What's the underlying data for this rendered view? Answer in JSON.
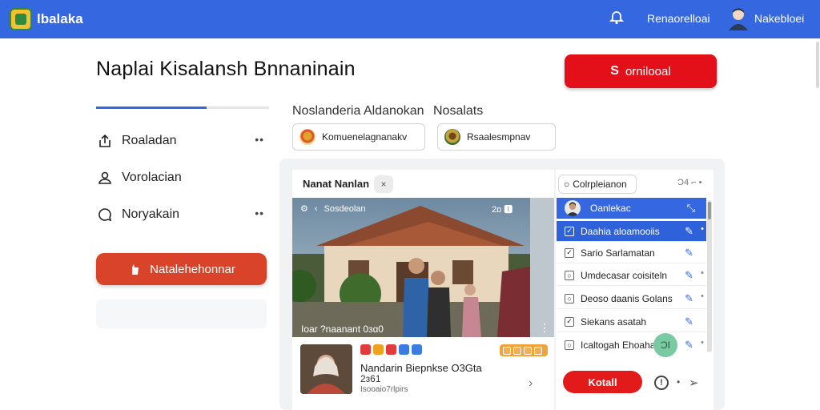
{
  "topbar": {
    "brand": "lbalaka",
    "link": "Renaorelloai",
    "user_name": "Nakebloei"
  },
  "header": {
    "title": "Naplai Kisalansh Bnnaninain",
    "primary_button": "ornilooal",
    "primary_button_icon": "S"
  },
  "sidebar": {
    "progress": 0.64,
    "items": [
      {
        "label": "Roaladan",
        "icon": "upload-icon",
        "more": "••"
      },
      {
        "label": "Vorolacian",
        "icon": "user-icon",
        "more": ""
      },
      {
        "label": "Noryakain",
        "icon": "chat-icon",
        "more": "••"
      }
    ],
    "action_button": "Natalehehonnar"
  },
  "filters": {
    "label_1": "Noslanderia Aldanokan",
    "label_2": "Nosalats",
    "select_1": "Komuenelagnanakv",
    "select_2": "Rsaalesmpnav"
  },
  "card": {
    "title": "Nanat Nanlan",
    "close": "×",
    "video": {
      "top_left": "Sosdeolan",
      "top_right": "2ɒ  🅸",
      "caption": "Ioar ?naanant 0ɜɑ0"
    },
    "list_item": {
      "title": "Nandarin Biepnkse O3Gta",
      "sub": "2ɜ61",
      "meta": "Isooaio7rlpirs"
    }
  },
  "right_panel": {
    "search": "Colrpleianon",
    "tools": "Ɔ4 ⌐ •",
    "rows": [
      {
        "label": "Oanlekac",
        "type": "head",
        "check": ""
      },
      {
        "label": "Daahia aloamooiis",
        "type": "sel",
        "check": "✓"
      },
      {
        "label": "Sario Sarlamatan",
        "type": "normal",
        "check": "✓"
      },
      {
        "label": "Umdecasar coisiteln",
        "type": "normal",
        "check": "○"
      },
      {
        "label": "Deoso daanis Golans",
        "type": "normal",
        "check": "○"
      },
      {
        "label": "Siekans asatah",
        "type": "normal",
        "check": "✓"
      },
      {
        "label": "Icaltogah Ehoahar",
        "type": "normal",
        "check": "○"
      }
    ],
    "fab": "ƆI",
    "action_button": "Kotall",
    "info": "!"
  },
  "colors": {
    "topbar": "#3467e0",
    "primary_red": "#e3101a",
    "side_button": "#d8432a",
    "accent_blue": "#3467e0"
  }
}
